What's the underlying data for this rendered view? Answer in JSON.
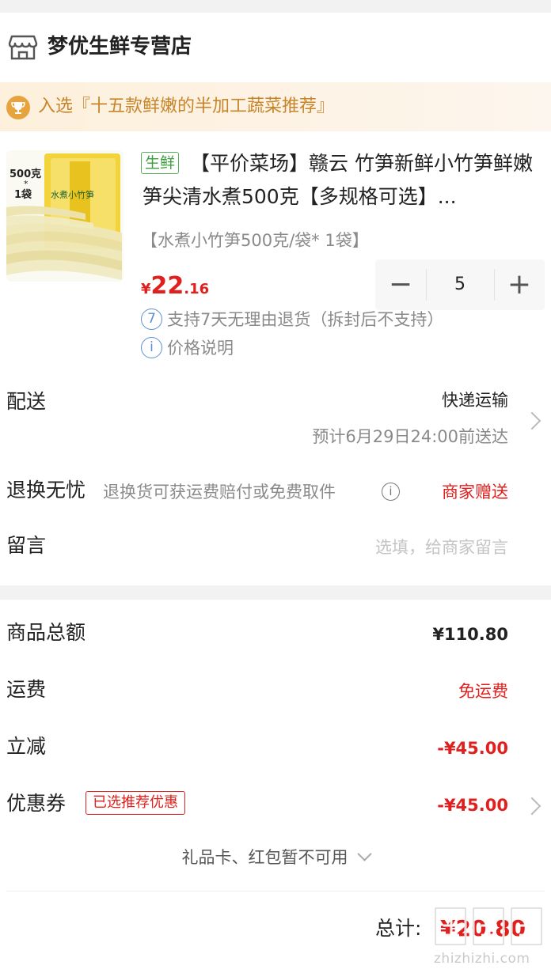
{
  "store": {
    "name": "梦优生鲜专营店",
    "icon": "store-icon"
  },
  "banner": {
    "text": "入选『十五款鲜嫩的半加工蔬菜推荐』",
    "icon": "trophy-icon"
  },
  "product": {
    "tag": "生鲜",
    "title": "【平价菜场】赣云 竹笋新鲜小竹笋鲜嫩笋尖清水煮500克【多规格可选】...",
    "spec": "【水煮小竹笋500克/袋* 1袋】",
    "price_symbol": "¥",
    "price_int": "22",
    "price_dec": ".16",
    "quantity": "5",
    "quantity_minus": "−",
    "quantity_plus": "+",
    "image_text_weight": "500克",
    "image_text_count": "1袋",
    "image_text_label": "水煮小竹笋",
    "services": [
      {
        "icon_text": "7",
        "text": "支持7天无理由退货（拆封后不支持）"
      },
      {
        "icon_text": "i",
        "text": "价格说明"
      }
    ]
  },
  "delivery": {
    "label": "配送",
    "method": "快递运输",
    "eta": "预计6月29日24:00前送达"
  },
  "returns": {
    "label": "退换无忧",
    "desc": "退换货可获运费赔付或免费取件",
    "value": "商家赠送"
  },
  "message": {
    "label": "留言",
    "placeholder": "选填，给商家留言"
  },
  "summary": {
    "goods_total_label": "商品总额",
    "goods_total_value": "¥110.80",
    "shipping_label": "运费",
    "shipping_value": "免运费",
    "discount_label": "立减",
    "discount_value": "-¥45.00",
    "coupon_label": "优惠券",
    "coupon_badge": "已选推荐优惠",
    "coupon_value": "-¥45.00",
    "gift_text": "礼品卡、红包暂不可用",
    "total_label": "总计:",
    "total_value": "¥20.80"
  },
  "watermark": {
    "text": "zhizhizhi.com"
  },
  "colors": {
    "price_red": "#e0201e",
    "fresh_green": "#3e9d3e",
    "banner_gold": "#c7852a",
    "info_blue": "#5d8fd0"
  }
}
